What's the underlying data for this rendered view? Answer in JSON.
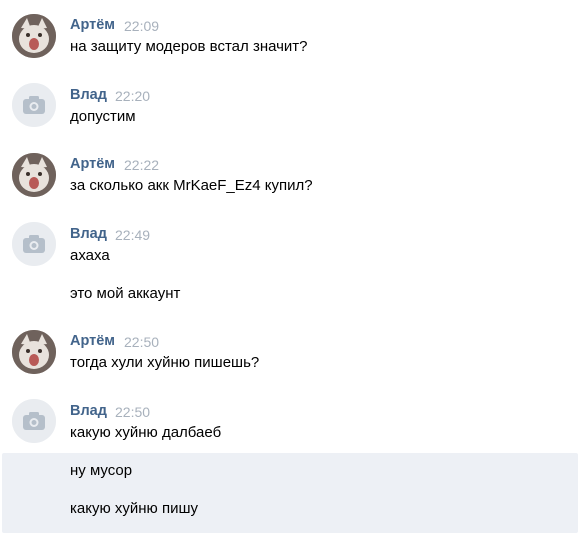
{
  "messages": [
    {
      "author": "Артём",
      "time": "22:09",
      "lines": [
        "на защиту модеров встал значит?"
      ],
      "avatar": "cat-photo"
    },
    {
      "author": "Влад",
      "time": "22:20",
      "lines": [
        "допустим"
      ],
      "avatar": "camera-placeholder"
    },
    {
      "author": "Артём",
      "time": "22:22",
      "lines": [
        "за сколько акк MrKaeF_Ez4 купил?"
      ],
      "avatar": "cat-photo"
    },
    {
      "author": "Влад",
      "time": "22:49",
      "lines": [
        "ахаха",
        "это мой аккаунт"
      ],
      "avatar": "camera-placeholder"
    },
    {
      "author": "Артём",
      "time": "22:50",
      "lines": [
        "тогда хули хуйню пишешь?"
      ],
      "avatar": "cat-photo"
    },
    {
      "author": "Влад",
      "time": "22:50",
      "lines": [
        "какую хуйню далбаеб",
        "ну мусор",
        "какую хуйню пишу"
      ],
      "avatar": "camera-placeholder"
    }
  ],
  "colors": {
    "author": "#42648b",
    "time": "#a8b1bc",
    "unread_bg": "#edf0f5"
  }
}
